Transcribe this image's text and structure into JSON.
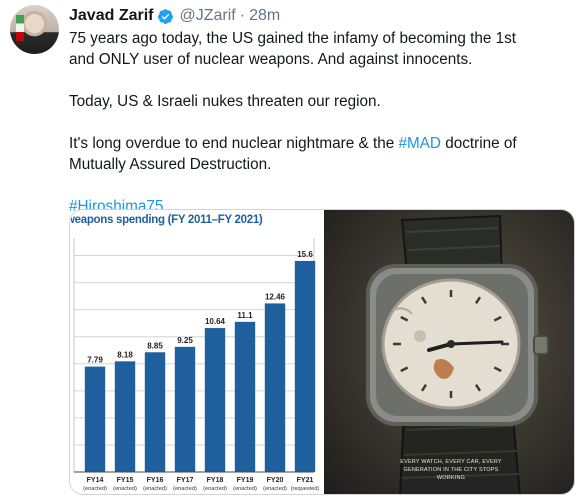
{
  "tweet": {
    "author_name": "Javad Zarif",
    "handle": "@JZarif",
    "separator": "·",
    "time": "28m",
    "lines": {
      "p1a": "75 years ago today, the US gained the infamy of becoming the 1st",
      "p1b": "and ONLY user of nuclear weapons. And against innocents.",
      "p2": "Today, US & Israeli nukes threaten our region.",
      "p3a_pre": "It's long overdue to end nuclear nightmare & the ",
      "p3a_tag": "#MAD",
      "p3a_post": " doctrine of",
      "p3b": "Mutually Assured Destruction.",
      "hashtag": "#Hiroshima75"
    }
  },
  "colors": {
    "link": "#1b95e0",
    "bar": "#1f5f9e",
    "verified": "#1da1f2"
  },
  "icons": [
    "verified-badge-icon"
  ],
  "media": {
    "caption": "EVERY WATCH, EVERY CAR, EVERY GENERATION IN THE CITY STOPS WORKING"
  },
  "chart_data": {
    "type": "bar",
    "title": "weapons spending (FY 2011–FY 2021)",
    "categories": [
      "FY14",
      "FY15",
      "FY16",
      "FY17",
      "FY18",
      "FY19",
      "FY20",
      "FY21"
    ],
    "sublabels": [
      "(enacted)",
      "(enacted)",
      "(enacted)",
      "(enacted)",
      "(enacted)",
      "(enacted)",
      "(enacted)",
      "(requested)"
    ],
    "values": [
      7.79,
      8.18,
      8.85,
      9.25,
      10.64,
      11.1,
      12.46,
      15.6
    ],
    "value_labels": [
      "7.79",
      "8.18",
      "8.85",
      "9.25",
      "10.64",
      "11.1",
      "12.46",
      "15.6"
    ],
    "ylim": [
      0,
      17
    ],
    "grid": true,
    "bar_color": "#1f5f9e"
  }
}
